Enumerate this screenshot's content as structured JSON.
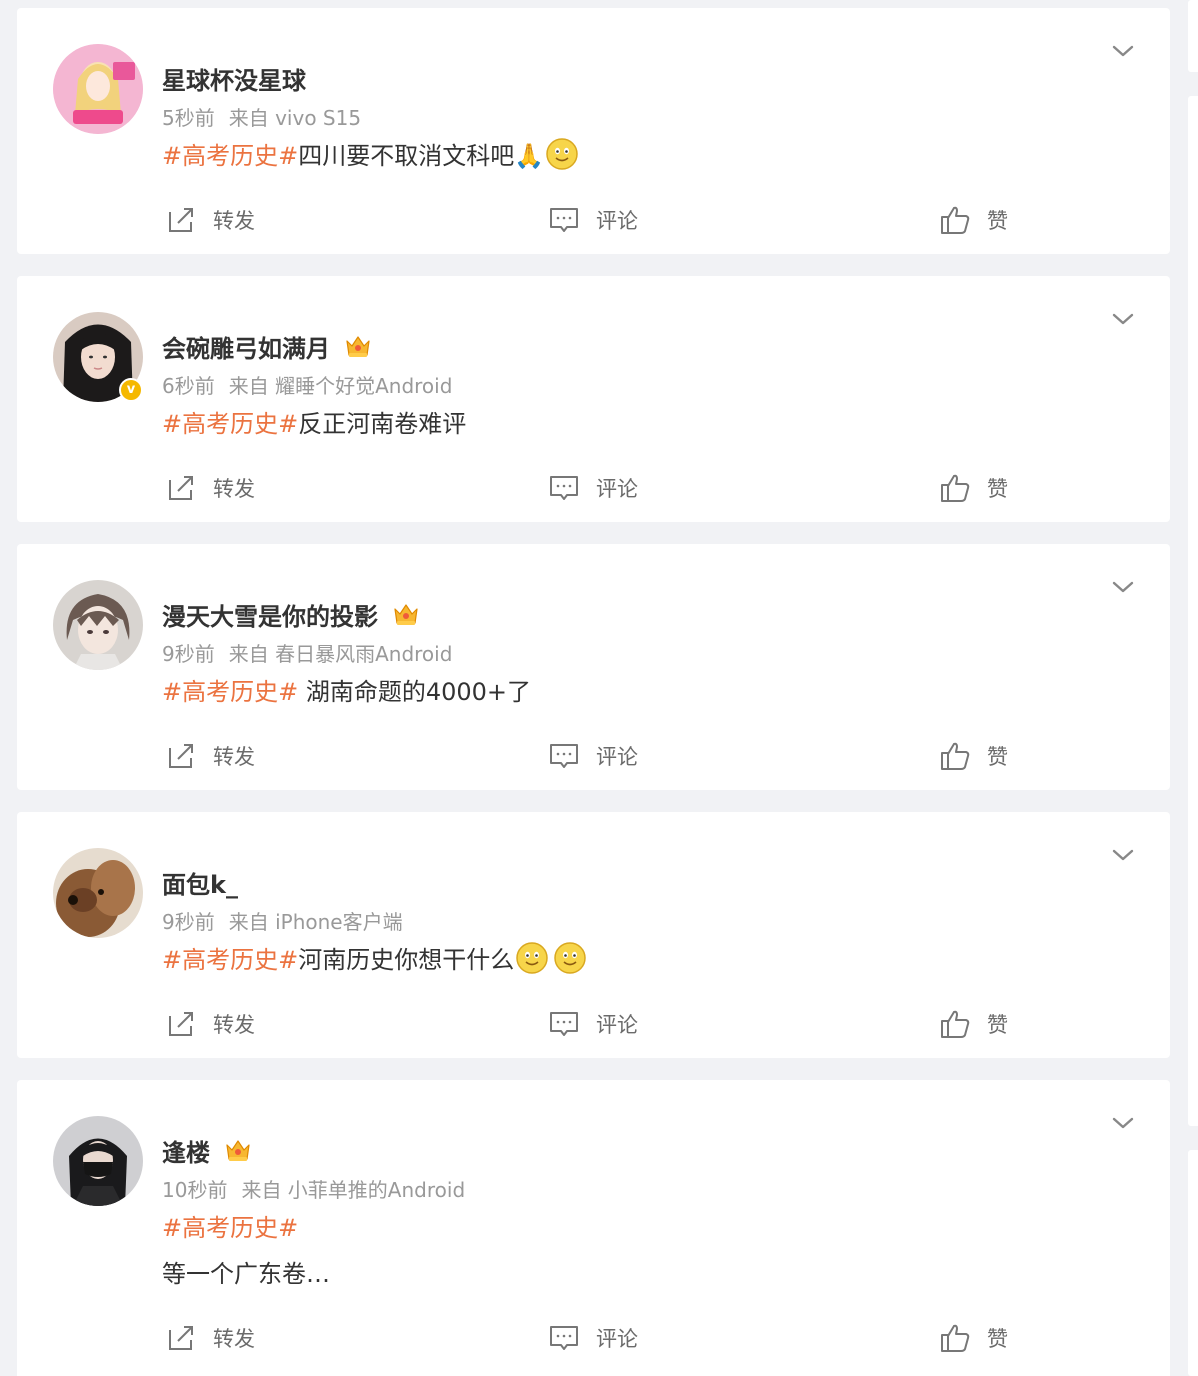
{
  "colors": {
    "topic": "#eb7340",
    "meta": "#999999",
    "verified": "#f5b800"
  },
  "actions": {
    "forward": "转发",
    "comment": "评论",
    "like": "赞"
  },
  "posts": [
    {
      "name": "星球杯没星球",
      "time": "5秒前",
      "source": "来自 vivo S15",
      "topic": "#高考历史#",
      "text": "四川要不取消文科吧🙏",
      "badge": null,
      "verified": false,
      "emojis": 1
    },
    {
      "name": "会碗雕弓如满月",
      "time": "6秒前",
      "source": "来自 耀睡个好觉Android",
      "topic": "#高考历史#",
      "text": "反正河南卷难评",
      "badge": "crown-icon",
      "verified": true,
      "verified_mark": "v",
      "emojis": 0
    },
    {
      "name": "漫天大雪是你的投影",
      "time": "9秒前",
      "source": "来自 春日暴风雨Android",
      "topic": "#高考历史#",
      "text": " 湖南命题的4000+了",
      "badge": "crown-icon",
      "verified": false,
      "emojis": 0
    },
    {
      "name": "面包k_",
      "time": "9秒前",
      "source": "来自 iPhone客户端",
      "topic": "#高考历史#",
      "text": "河南历史你想干什么",
      "badge": null,
      "verified": false,
      "emojis": 2
    },
    {
      "name": "逢楼",
      "time": "10秒前",
      "source": "来自 小菲单推的Android",
      "topic": "#高考历史#",
      "text": "",
      "text2": "等一个广东卷…",
      "badge": "crown-icon",
      "verified": false,
      "emojis": 0
    }
  ]
}
